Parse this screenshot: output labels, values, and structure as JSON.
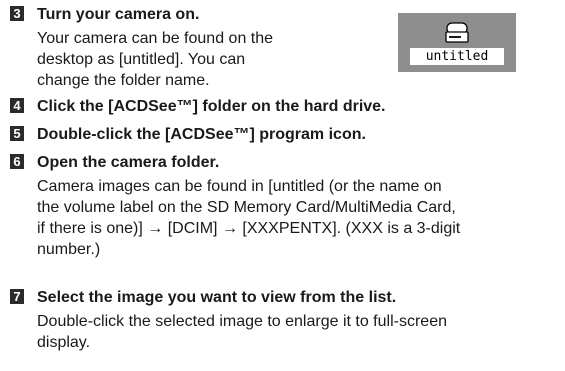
{
  "colors": {
    "step_badge": "#2b2b2b",
    "icon_panel": "#8e8e8e",
    "text": "#1a1a1a"
  },
  "volume_icon": {
    "icon": "drive-icon",
    "label": "untitled"
  },
  "steps": [
    {
      "number": "3",
      "title": "Turn your camera on.",
      "lines": [
        "Your camera can be found on the",
        "desktop as [untitled]. You can",
        "change the folder name."
      ]
    },
    {
      "number": "4",
      "title": "Click the [ACDSee™] folder on the hard drive.",
      "lines": []
    },
    {
      "number": "5",
      "title": "Double-click the [ACDSee™] program icon.",
      "lines": []
    },
    {
      "number": "6",
      "title": "Open the camera folder.",
      "lines": [
        "Camera images can be found in [untitled (or the name on",
        "the volume label on the SD Memory Card/MultiMedia Card,",
        "if there is one)] → [DCIM] → [XXXPENTX]. (XXX is a 3-digit",
        "number.)"
      ]
    },
    {
      "number": "7",
      "title": "Select the image you want to view from the list.",
      "lines": [
        "Double-click the selected image to enlarge it to full-screen",
        "display."
      ]
    }
  ]
}
